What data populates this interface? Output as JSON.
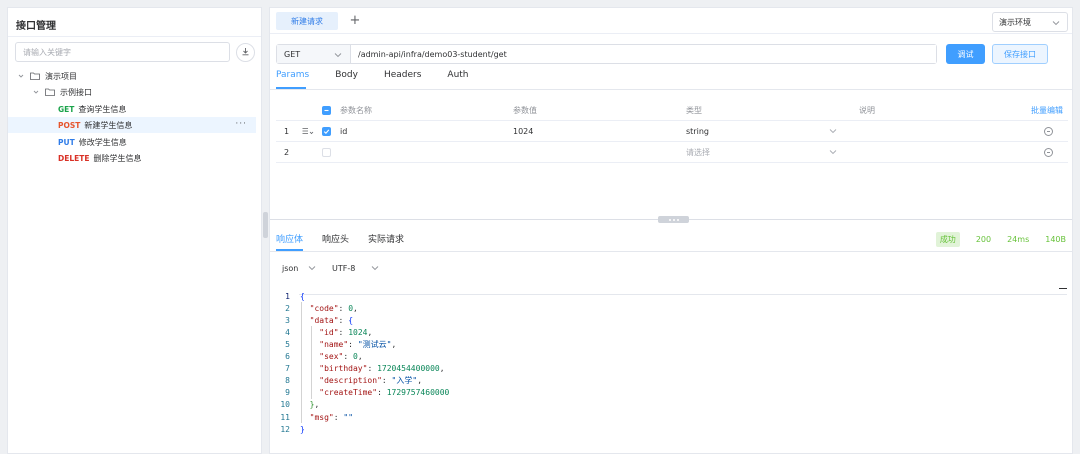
{
  "left_panel": {
    "title": "接口管理",
    "search_placeholder": "请输入关键字",
    "tree": {
      "project_label": "演示项目",
      "folder_label": "示例接口",
      "endpoints": [
        {
          "method": "GET",
          "label": "查询学生信息"
        },
        {
          "method": "POST",
          "label": "新建学生信息",
          "selected": true,
          "more": "···"
        },
        {
          "method": "PUT",
          "label": "修改学生信息"
        },
        {
          "method": "DELETE",
          "label": "删除学生信息"
        }
      ]
    }
  },
  "tabs": {
    "active_label": "新建请求",
    "add_label": "+"
  },
  "environment": {
    "selected": "演示环境"
  },
  "request": {
    "method": "GET",
    "url": "/admin-api/infra/demo03-student/get",
    "debug_label": "调试",
    "save_label": "保存接口",
    "tabs": [
      "Params",
      "Body",
      "Headers",
      "Auth"
    ]
  },
  "params": {
    "headers": {
      "name": "参数名称",
      "value": "参数值",
      "type": "类型",
      "desc": "说明",
      "bulk_edit": "批量编辑"
    },
    "rows": [
      {
        "index": "1",
        "drag": "≡",
        "checked": true,
        "name": "id",
        "value": "1024",
        "type": "string"
      },
      {
        "index": "2",
        "checked": false,
        "name": "",
        "value": "",
        "type": "请选择"
      }
    ]
  },
  "response": {
    "tabs": [
      "响应体",
      "响应头",
      "实际请求"
    ],
    "status_label": "成功",
    "status_code": "200",
    "time": "24ms",
    "size": "140B",
    "format": "json",
    "encoding": "UTF-8",
    "code_lines": [
      "{",
      "  \"code\": 0,",
      "  \"data\": {",
      "    \"id\": 1024,",
      "    \"name\": \"测试云\",",
      "    \"sex\": 0,",
      "    \"birthday\": 1720454400000,",
      "    \"description\": \"入学\",",
      "    \"createTime\": 1729757460000",
      "  },",
      "  \"msg\": \"\"",
      "}"
    ]
  },
  "colors": {
    "accent": "#409eff",
    "get": "#1aa34a",
    "post": "#e6542c",
    "put": "#2f7ce8",
    "delete": "#d93025",
    "success": "#67c23a"
  }
}
